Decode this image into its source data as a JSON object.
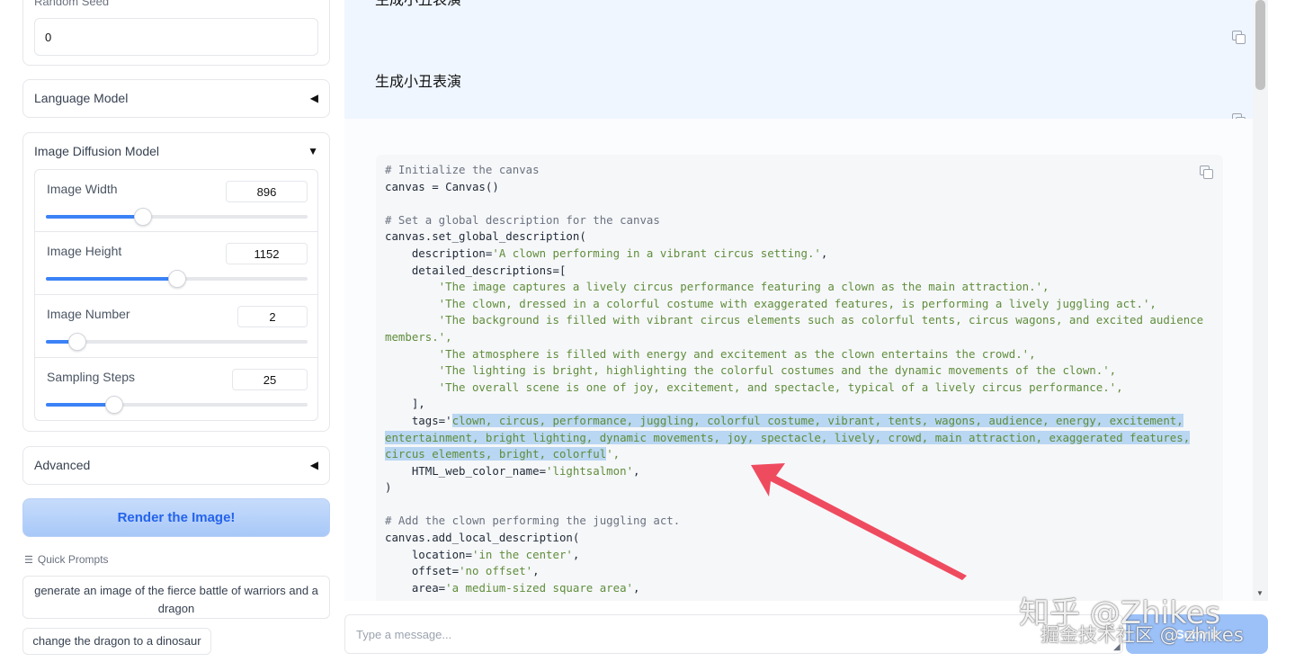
{
  "left_panel": {
    "seed": {
      "label": "Random Seed",
      "value": "0"
    },
    "language_model": {
      "label": "Language Model",
      "toggle": "◀"
    },
    "image_diffusion": {
      "label": "Image Diffusion Model",
      "toggle": "▼",
      "sliders": [
        {
          "label": "Image Width",
          "value": "896",
          "fraction": 0.37
        },
        {
          "label": "Image Height",
          "value": "1152",
          "fraction": 0.5
        },
        {
          "label": "Image Number",
          "value": "2",
          "fraction": 0.12
        },
        {
          "label": "Sampling Steps",
          "value": "25",
          "fraction": 0.26
        }
      ]
    },
    "advanced": {
      "label": "Advanced",
      "toggle": "◀"
    },
    "render_button": "Render the Image!",
    "quick_prompts": {
      "label": "Quick Prompts",
      "items": [
        "generate an image of the fierce battle of warriors and a dragon",
        "change the dragon to a dinosaur"
      ]
    }
  },
  "chat": {
    "top_message": "生成小丑表演",
    "user_message": "生成小丑表演",
    "code": {
      "l1": "# Initialize the canvas",
      "l2": "canvas = Canvas()",
      "l3": "# Set a global description for the canvas",
      "l4": "canvas.set_global_description(",
      "l5a": "    description=",
      "l5b": "'A clown performing in a vibrant circus setting.'",
      "l6": "    detailed_descriptions=[",
      "l7": "        'The image captures a lively circus performance featuring a clown as the main attraction.',",
      "l8": "        'The clown, dressed in a colorful costume with exaggerated features, is performing a lively juggling act.',",
      "l9": "        'The background is filled with vibrant circus elements such as colorful tents, circus wagons, and excited audience",
      "l10": "members.',",
      "l11": "        'The atmosphere is filled with energy and excitement as the clown entertains the crowd.',",
      "l12": "        'The lighting is bright, highlighting the colorful costumes and the dynamic movements of the clown.',",
      "l13": "        'The overall scene is one of joy, excitement, and spectacle, typical of a lively circus performance.',",
      "l14": "    ],",
      "l15a": "    tags='",
      "l15b": "clown, circus, performance, juggling, colorful costume, vibrant, tents, wagons, audience, energy, excitement,",
      "l16": "entertainment, bright lighting, dynamic movements, joy, spectacle, lively, crowd, main attraction, exaggerated features,",
      "l17a": "circus elements, bright, colorful",
      "l17b": "',",
      "l18a": "    HTML_web_color_name=",
      "l18b": "'lightsalmon'",
      "l18c": ",",
      "l19": ")",
      "l20": "# Add the clown performing the juggling act.",
      "l21": "canvas.add_local_description(",
      "l22a": "    location=",
      "l22b": "'in the center'",
      "l23a": "    offset=",
      "l23b": "'no offset'",
      "l24a": "    area=",
      "l24b": "'a medium-sized square area'",
      "comma": ","
    }
  },
  "input": {
    "placeholder": "Type a message...",
    "submit": "Submit"
  },
  "watermarks": {
    "zhihu": "知乎 @Zhikes",
    "juejin": "掘金技术社区 @ zhikes"
  },
  "colors": {
    "accent": "#3b82f6",
    "arrow": "#ef4b5f",
    "chat_bg": "#eff6ff"
  }
}
